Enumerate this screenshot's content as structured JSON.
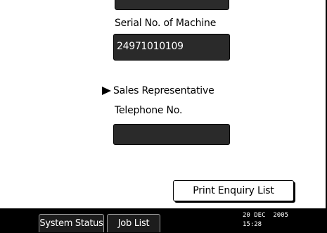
{
  "form": {
    "serial_label": "Serial No. of Machine",
    "serial_value": "24971010109",
    "sales_label": "Sales Representative",
    "telephone_label": "Telephone No.",
    "telephone_value": ""
  },
  "actions": {
    "print_label": "Print Enquiry List"
  },
  "status_bar": {
    "tabs": [
      {
        "label": "System Status"
      },
      {
        "label": "Job List"
      }
    ],
    "date": "20 DEC  2005",
    "time": "15:28"
  },
  "icons": {
    "section_marker": "right-triangle-icon"
  },
  "colors": {
    "field_background": "#2a2a2a",
    "screen_background": "#ffffff",
    "status_bar_background": "#000000"
  }
}
